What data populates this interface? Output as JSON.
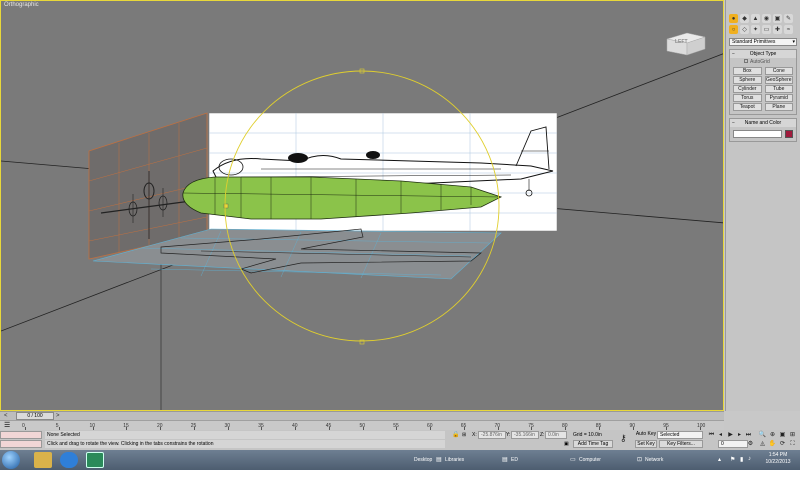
{
  "viewport": {
    "label": "Orthographic",
    "viewcube_face": "LEFT"
  },
  "command_panel": {
    "primitive_type": "Standard Primitives",
    "object_type_title": "Object Type",
    "autogrid_label": "AutoGrid",
    "buttons": [
      "Box",
      "Cone",
      "Sphere",
      "GeoSphere",
      "Cylinder",
      "Tube",
      "Torus",
      "Pyramid",
      "Teapot",
      "Plane"
    ],
    "name_color_title": "Name and Color",
    "object_color": "#a01a3c"
  },
  "timeline": {
    "frame": "0 / 100",
    "ticks": [
      0,
      5,
      10,
      15,
      20,
      25,
      30,
      35,
      40,
      45,
      50,
      55,
      60,
      65,
      70,
      75,
      80,
      85,
      90,
      95,
      100
    ]
  },
  "status": {
    "selection": "None Selected",
    "prompt": "Click and drag to rotate the view.  Clicking in the tabs constrains the rotation",
    "x_label": "X:",
    "x_value": "-25.876in",
    "y_label": "Y:",
    "y_value": "-35.166in",
    "z_label": "Z:",
    "z_value": "0.0in",
    "grid": "Grid = 10.0in",
    "add_time_tag": "Add Time Tag",
    "auto_key": "Auto Key",
    "selected_dropdown": "Selected",
    "set_key": "Set Key",
    "key_filters": "Key Filters...",
    "current_frame": "0"
  },
  "taskbar": {
    "desktop": "Desktop",
    "libraries": "Libraries",
    "ed": "ED",
    "computer": "Computer",
    "network": "Network",
    "time": "1:54 PM",
    "date": "10/22/2013"
  },
  "colors": {
    "viewport_bg": "#7a7a7a",
    "active_viewport_border": "#e8d83a",
    "mesh_green": "#8bc34a",
    "gizmo_yellow": "#e0cf2e"
  }
}
